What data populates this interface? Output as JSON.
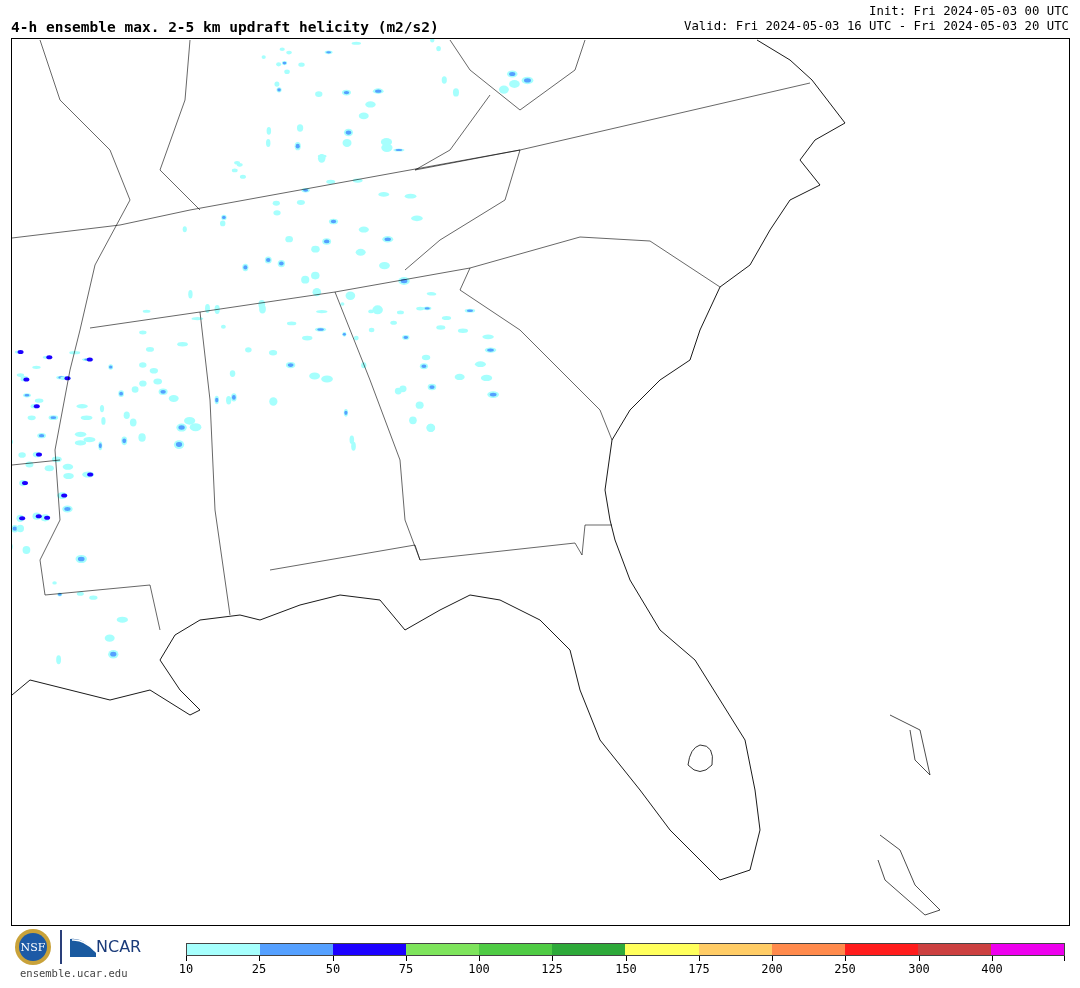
{
  "header": {
    "title": "4-h ensemble max. 2-5 km updraft helicity (m2/s2)",
    "init": "Init: Fri 2024-05-03 00 UTC",
    "valid": "Valid: Fri 2024-05-03 16 UTC - Fri 2024-05-03 20 UTC"
  },
  "footer": {
    "nsf_seal": "NSF",
    "ncar_logo": "NCAR",
    "url": "ensemble.ucar.edu"
  },
  "colorbar": [
    {
      "label": "10",
      "color": "#a6fffd"
    },
    {
      "label": "25",
      "color": "#55a0ff"
    },
    {
      "label": "50",
      "color": "#1c00ff"
    },
    {
      "label": "75",
      "color": "#7ee45c"
    },
    {
      "label": "100",
      "color": "#4fcb44"
    },
    {
      "label": "125",
      "color": "#2ea93a"
    },
    {
      "label": "150",
      "color": "#ffff5c"
    },
    {
      "label": "175",
      "color": "#ffcc66"
    },
    {
      "label": "200",
      "color": "#ff8a4c"
    },
    {
      "label": "250",
      "color": "#ff1c1c"
    },
    {
      "label": "300",
      "color": "#cc4040"
    },
    {
      "label": "400",
      "color": "#ee00ee"
    }
  ]
}
